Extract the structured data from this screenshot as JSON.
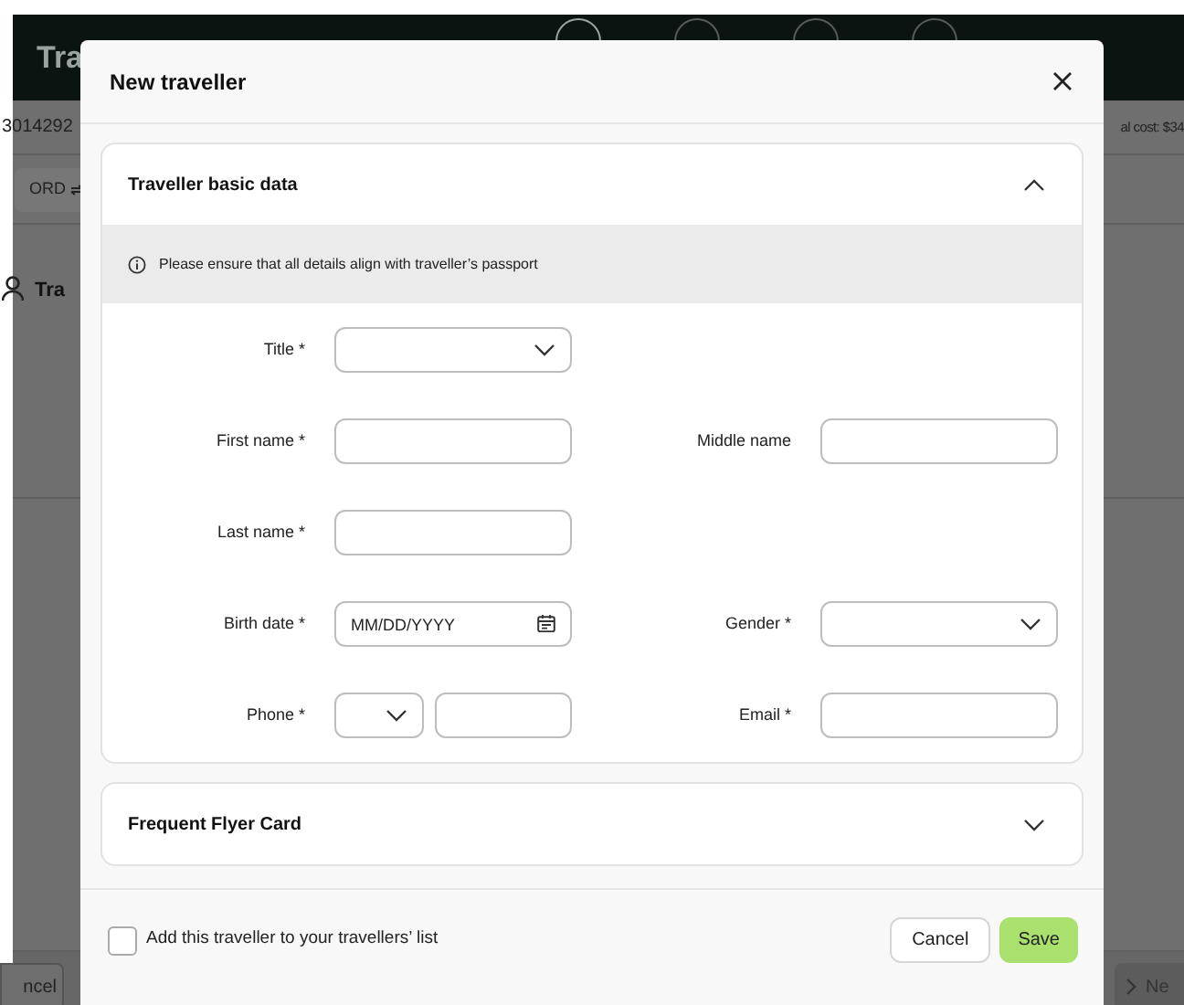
{
  "background": {
    "page_title": "Tra",
    "order_ref": "3014292",
    "total_cost": "al cost: $34",
    "route_chip": "ORD",
    "section_title": "Tra",
    "buttons": [
      {
        "label": "ncel",
        "kind": "secondary"
      },
      {
        "label": "Ne",
        "kind": "next"
      }
    ]
  },
  "dialog": {
    "title": "New traveller",
    "sections": [
      {
        "title": "Traveller basic data",
        "expanded": true,
        "notice": "Please ensure that all details align with traveller’s passport",
        "rows": [
          [
            {
              "label": "Title *",
              "kind": "select"
            }
          ],
          [
            {
              "label": "First name *",
              "kind": "text"
            },
            {
              "label": "Middle name",
              "kind": "text"
            }
          ],
          [
            {
              "label": "Last name *",
              "kind": "text"
            }
          ],
          [
            {
              "label": "Birth date *",
              "kind": "date",
              "placeholder": "MM/DD/YYYY"
            },
            {
              "label": "Gender *",
              "kind": "select"
            }
          ],
          [
            {
              "label": "Phone *",
              "kind": "phone"
            },
            {
              "label": "Email *",
              "kind": "text"
            }
          ]
        ]
      },
      {
        "title": "Frequent Flyer Card",
        "expanded": false
      }
    ],
    "footer": {
      "checkbox": {
        "label": "Add this traveller to your travellers’ list",
        "checked": false
      },
      "buttons": [
        {
          "label": "Cancel",
          "kind": "secondary"
        },
        {
          "label": "Save",
          "kind": "primary"
        }
      ]
    }
  }
}
